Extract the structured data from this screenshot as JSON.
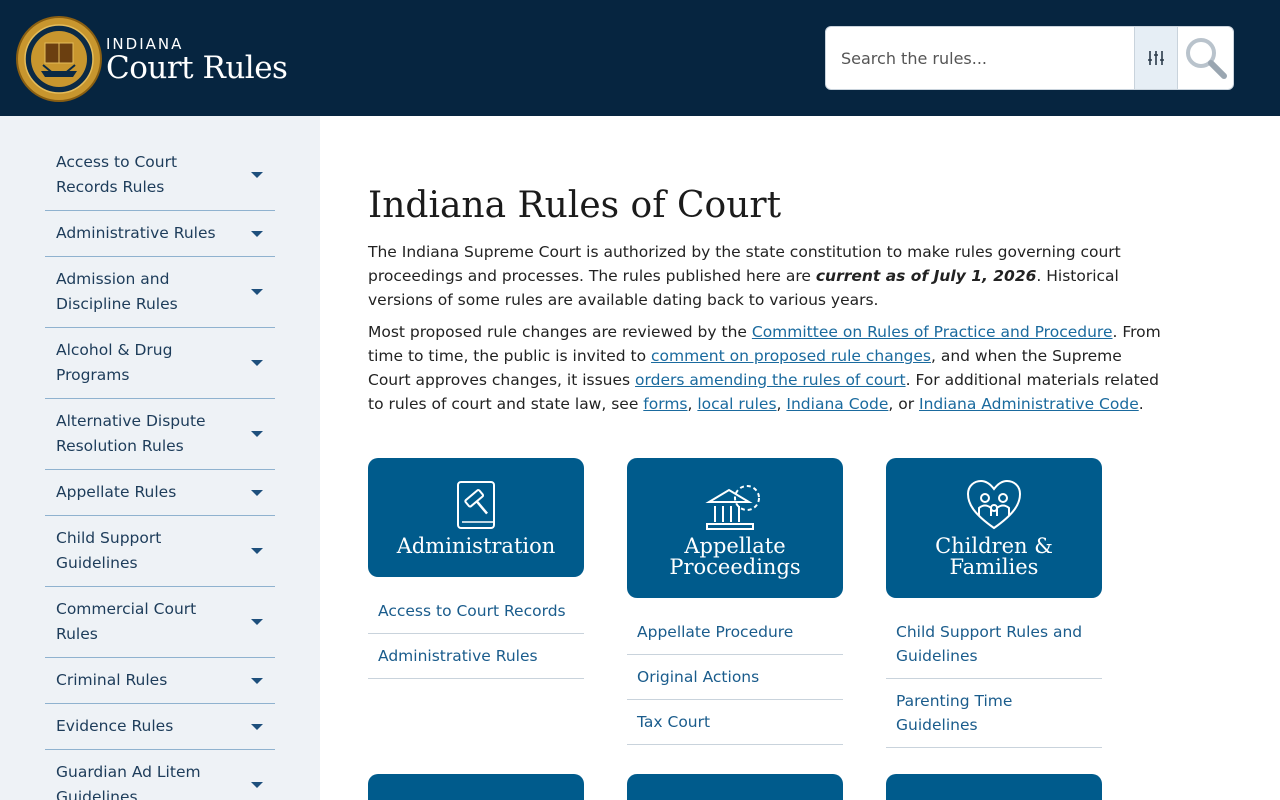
{
  "header": {
    "brand_small": "INDIANA",
    "brand_big": "Court Rules",
    "logo_icon": "supreme-court-seal-icon"
  },
  "search": {
    "placeholder": "Search the rules..."
  },
  "sidebar": {
    "items": [
      {
        "label": "Access to Court Records Rules"
      },
      {
        "label": "Administrative Rules"
      },
      {
        "label": "Admission and Discipline Rules"
      },
      {
        "label": "Alcohol & Drug Programs"
      },
      {
        "label": "Alternative Dispute Resolution Rules"
      },
      {
        "label": "Appellate Rules"
      },
      {
        "label": "Child Support Guidelines"
      },
      {
        "label": "Commercial Court Rules"
      },
      {
        "label": "Criminal Rules"
      },
      {
        "label": "Evidence Rules"
      },
      {
        "label": "Guardian Ad Litem Guidelines"
      }
    ]
  },
  "main": {
    "title": "Indiana Rules of Court",
    "p1_a": "The Indiana Supreme Court is authorized by the state constitution to make rules governing court proceedings and processes. The rules published here are ",
    "p1_strong": "current as of July 1, 2026",
    "p1_b": ". Historical versions of some rules are available dating back to various years.",
    "p2_a": "Most proposed rule changes are reviewed by the ",
    "link_committee": "Committee on Rules of Practice and Procedure",
    "p2_b": ". From time to time, the public is invited to ",
    "link_comment": "comment on proposed rule changes",
    "p2_c": ", and when the Supreme Court approves changes, it issues ",
    "link_orders": "orders amending the rules of court",
    "p2_d": ". For additional materials related to rules of court and state law, see ",
    "link_forms": "forms",
    "sep1": ", ",
    "link_local": "local rules",
    "sep2": ", ",
    "link_code": "Indiana Code",
    "sep3": ", or ",
    "link_admin_code": "Indiana Administrative Code",
    "p2_e": "."
  },
  "cards": [
    {
      "title_line1": "Administration",
      "title_line2": "",
      "icon": "gavel-book-icon",
      "links": [
        "Access to Court Records",
        "Administrative Rules"
      ]
    },
    {
      "title_line1": "Appellate",
      "title_line2": "Proceedings",
      "icon": "courthouse-gear-icon",
      "links": [
        "Appellate Procedure",
        "Original Actions",
        "Tax Court"
      ]
    },
    {
      "title_line1": "Children &",
      "title_line2": "Families",
      "icon": "family-heart-icon",
      "links": [
        "Child Support Rules and Guidelines",
        "Parenting Time Guidelines"
      ]
    }
  ],
  "colors": {
    "header_bg": "#062540",
    "card_bg": "#005b8c",
    "link": "#1a6a9e",
    "sidebar_bg": "#eef2f6"
  }
}
